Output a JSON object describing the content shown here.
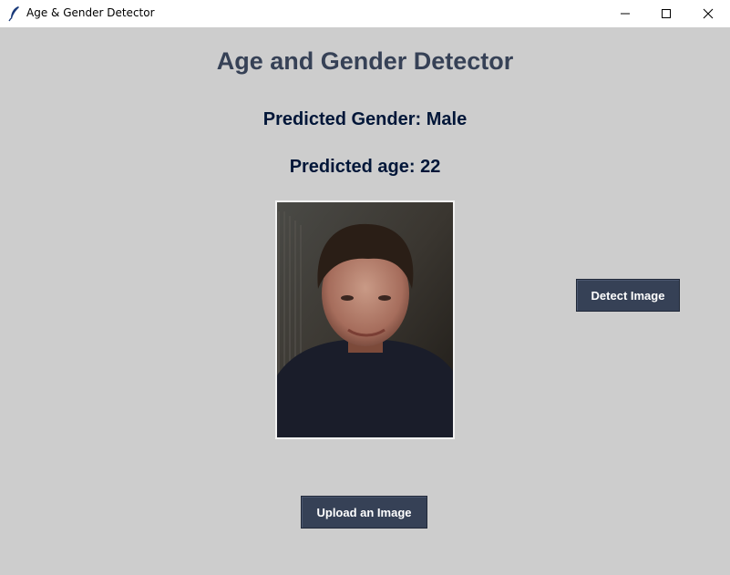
{
  "window": {
    "title": "Age & Gender Detector",
    "app_icon": "feather-icon",
    "controls": [
      "minimize-icon",
      "maximize-icon",
      "close-icon"
    ]
  },
  "main": {
    "heading": "Age and Gender Detector",
    "predicted_gender": "Predicted Gender: Male",
    "predicted_age": "Predicted age: 22",
    "image": "uploaded-face-photo"
  },
  "buttons": {
    "detect_label": "Detect Image",
    "upload_label": "Upload an Image"
  },
  "colors": {
    "background": "#cdcdcd",
    "heading": "#364156",
    "prediction_text": "#011638",
    "button_bg": "#364156",
    "button_text": "#ffffff"
  }
}
